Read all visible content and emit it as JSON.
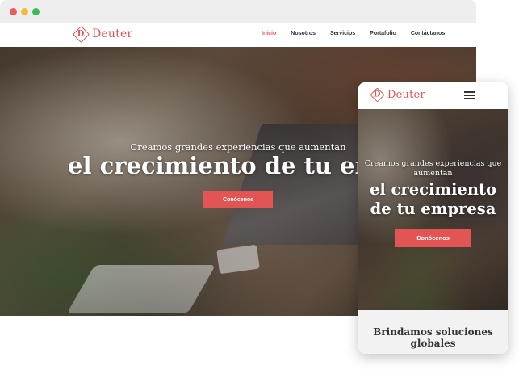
{
  "brand": {
    "logo_letter": "D",
    "name": "Deuter",
    "accent_color": "#e35454"
  },
  "nav": {
    "items": [
      "Inicio",
      "Nosotros",
      "Servicios",
      "Portafolio",
      "Contáctanos"
    ],
    "active_index": 0
  },
  "hero": {
    "subtitle": "Creamos grandes experiencias que aumentan",
    "title": "el crecimiento de tu empresa",
    "cta_label": "Conócenos"
  },
  "mobile": {
    "hero_subtitle": "Creamos grandes experiencias que aumentan",
    "hero_title": "el crecimiento de tu empresa",
    "cta_label": "Conócenos",
    "section_title": "Brindamos soluciones globales",
    "menu_icon": "hamburger-icon"
  }
}
